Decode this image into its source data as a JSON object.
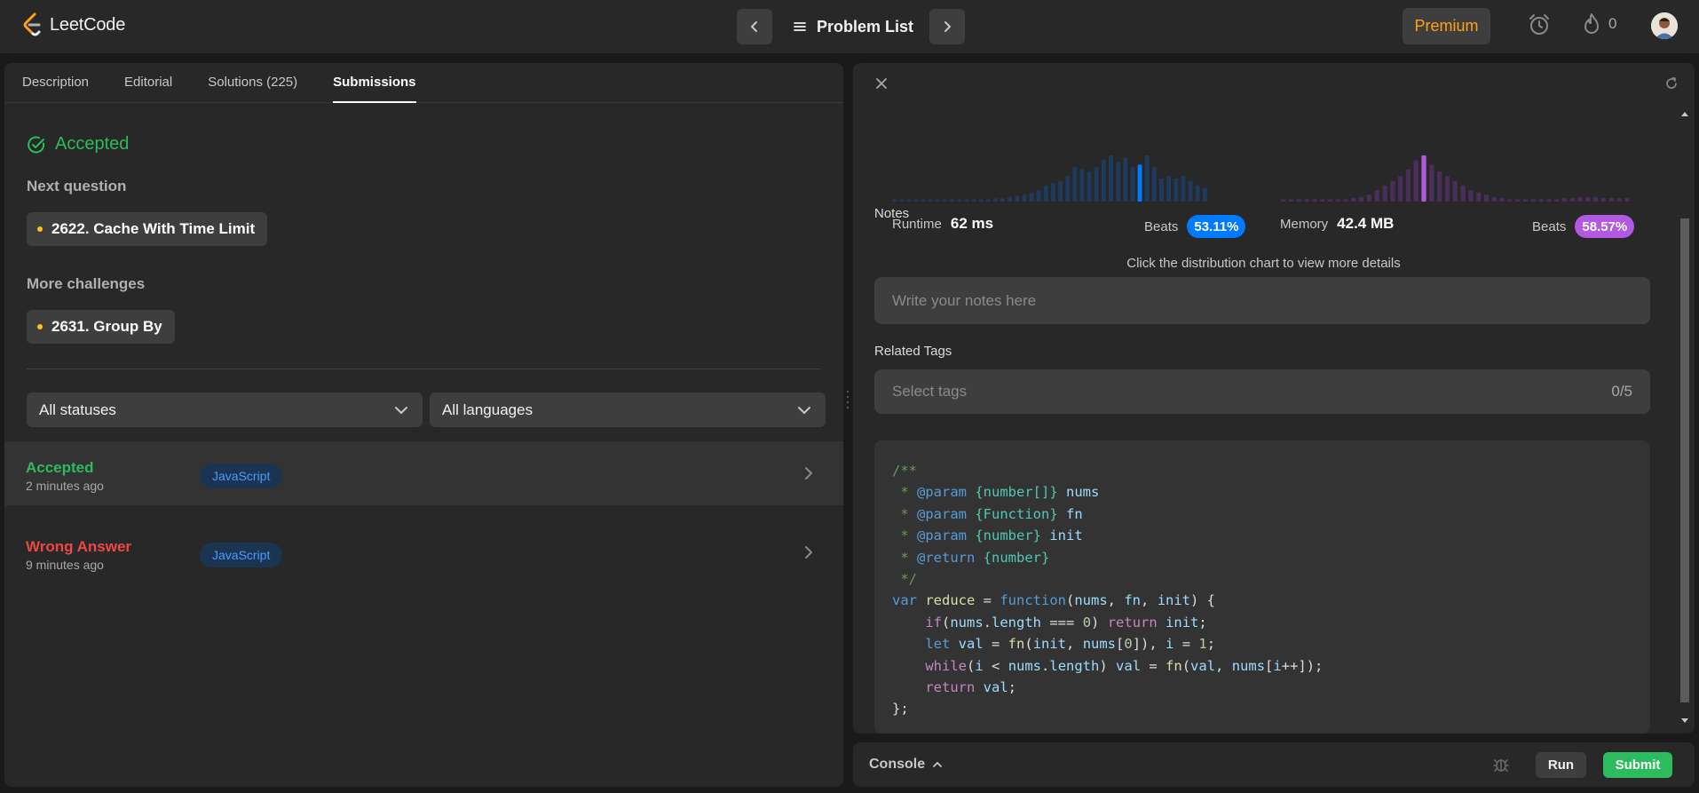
{
  "topbar": {
    "logo_text": "LeetCode",
    "problem_list_label": "Problem List",
    "premium_label": "Premium",
    "streak_count": "0",
    "colors": {
      "premium": "#ffa116",
      "accent": "#ffa116"
    }
  },
  "left": {
    "tabs": [
      {
        "label": "Description",
        "active": false
      },
      {
        "label": "Editorial",
        "active": false
      },
      {
        "label": "Solutions (225)",
        "active": false
      },
      {
        "label": "Submissions",
        "active": true
      }
    ],
    "status_title": "Accepted",
    "next_question_label": "Next question",
    "next_question": "2622. Cache With Time Limit",
    "more_challenges_label": "More challenges",
    "more_challenge": "2631. Group By",
    "status_filter": "All statuses",
    "language_filter": "All languages",
    "submissions": [
      {
        "status": "Accepted",
        "time": "2 minutes ago",
        "language": "JavaScript",
        "status_color": "#2cbb5d"
      },
      {
        "status": "Wrong Answer",
        "time": "9 minutes ago",
        "language": "JavaScript",
        "status_color": "#ef4743"
      }
    ]
  },
  "right": {
    "runtime": {
      "label": "Runtime",
      "value": "62 ms",
      "beats_label": "Beats",
      "beats_value": "53.11%",
      "color": "#007aff"
    },
    "memory": {
      "label": "Memory",
      "value": "42.4 MB",
      "beats_label": "Beats",
      "beats_value": "58.57%",
      "color": "#b358e0"
    },
    "hint": "Click the distribution chart to view more details",
    "notes_label": "Notes",
    "notes_placeholder": "Write your notes here",
    "related_tags_label": "Related Tags",
    "tags_placeholder": "Select tags",
    "tags_count": "0/5"
  },
  "code": {
    "lines": [
      "/**",
      " * @param {number[]} nums",
      " * @param {Function} fn",
      " * @param {number} init",
      " * @return {number}",
      " */",
      "var reduce = function(nums, fn, init) {",
      "    if(nums.length === 0) return init;",
      "    let val = fn(init, nums[0]), i = 1;",
      "    while(i < nums.length) val = fn(val, nums[i++]);",
      "    return val;",
      "};"
    ]
  },
  "console": {
    "label": "Console",
    "run_label": "Run",
    "submit_label": "Submit"
  },
  "chart_data": [
    {
      "type": "bar",
      "series_name": "Runtime distribution",
      "values": [
        2,
        2,
        2,
        2,
        2,
        2,
        2,
        2,
        2,
        2,
        2,
        2,
        2,
        2,
        3,
        3,
        4,
        5,
        6,
        8,
        10,
        14,
        16,
        18,
        22,
        30,
        28,
        26,
        30,
        36,
        40,
        34,
        38,
        30,
        32,
        40,
        30,
        20,
        22,
        20,
        22,
        18,
        14,
        12
      ],
      "highlight_index": 34,
      "color": "#007aff"
    },
    {
      "type": "bar",
      "series_name": "Memory distribution",
      "values": [
        2,
        2,
        2,
        2,
        2,
        2,
        2,
        2,
        2,
        3,
        4,
        6,
        10,
        14,
        18,
        22,
        28,
        36,
        40,
        32,
        26,
        22,
        18,
        14,
        10,
        8,
        6,
        4,
        3,
        2,
        2,
        2,
        2,
        2,
        2,
        2,
        3,
        3,
        4,
        4,
        4,
        3,
        3,
        3,
        3
      ],
      "highlight_index": 18,
      "color": "#b358e0"
    }
  ]
}
